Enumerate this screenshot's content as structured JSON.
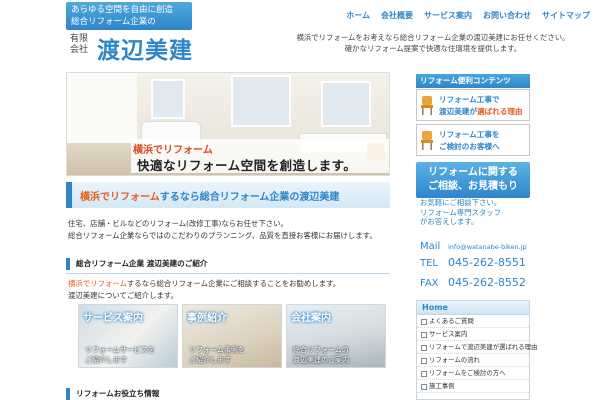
{
  "header": {
    "logo_line1": "あらゆる空間を自由に創造",
    "logo_line2": "総合リフォーム企業の",
    "logo_sub": "有限会社",
    "logo_name": "渡辺美建",
    "tagline_line1": "横浜でリフォームをお考えなら総合リフォーム企業の渡辺美建にお任せください。",
    "tagline_line2": "確かなリフォーム提案で快適な住環境を提供します。",
    "nav": [
      "ホーム",
      "会社概要",
      "サービス案内",
      "お問い合わせ",
      "サイトマップ"
    ]
  },
  "hero": {
    "red_text": "横浜でリフォーム",
    "title": "快適なリフォーム空間を創造します。"
  },
  "main": {
    "heading_red": "横浜でリフォーム",
    "heading_rest": "するなら総合リフォーム企業の渡辺美建",
    "text_line1": "住宅、店舗・ビルなどのリフォーム(改修工事)ならお任せ下さい。",
    "text_line2": "総合リフォーム企業ならではのこだわりのプランニング、品質を直接お客様にお届けします。",
    "intro_heading": "総合リフォーム企業 渡辺美建のご紹介",
    "intro_red": "横浜でリフォーム",
    "intro_rest": "するなら総合リフォーム企業にご相談することをお勧めします。",
    "intro_line2": "渡辺美建についてご紹介します。",
    "cards": [
      {
        "title": "サービス案内",
        "caption1": "リフォームサービスを",
        "caption2": "ご紹介します"
      },
      {
        "title": "事例紹介",
        "caption1": "リフォーム事例を",
        "caption2": "ご紹介します"
      },
      {
        "title": "会社案内",
        "caption1": "総合リフォームの",
        "caption2": "渡辺美建のご案内"
      }
    ],
    "tips_heading": "リフォームお役立ち情報"
  },
  "sidebar": {
    "contents_head": "リフォーム便利コンテンツ",
    "banner1_line1": "リフォーム工事で",
    "banner1_line2_blue": "渡辺美建が",
    "banner1_line2_red": "選ばれる理由",
    "banner2_line1": "リフォーム工事を",
    "banner2_line2": "ご検討のお客様へ",
    "consult_line1": "リフォームに関する",
    "consult_line2": "ご相談、お見積もり",
    "consult_desc1": "お気軽にご相談下さい。",
    "consult_desc2": "リフォーム専門スタッフ",
    "consult_desc3": "がお答えします。",
    "mail_label": "Mail",
    "mail_value": "info@watanabe-biken.jp",
    "tel_label": "TEL",
    "tel_value": "045-262-8551",
    "fax_label": "FAX",
    "fax_value": "045-262-8552",
    "nav_head": "Home",
    "nav_items": [
      "よくあるご質問",
      "サービス案内",
      "リフォームで渡辺美建が選ばれる理由",
      "リフォームの流れ",
      "リフォームをご検討の方へ",
      "施工事例"
    ]
  },
  "colors": {
    "accent": "#2e86c9",
    "highlight": "#e65c1e"
  }
}
